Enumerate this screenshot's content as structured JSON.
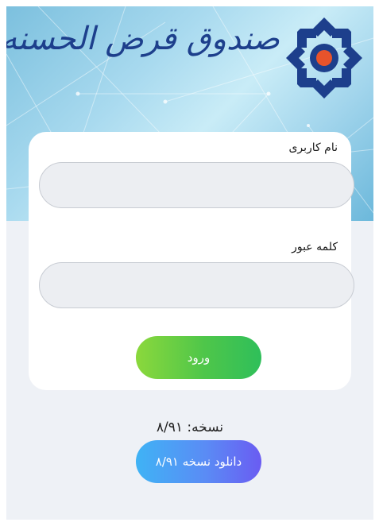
{
  "header": {
    "logo_text": "صندوق قرض الحسنه جام جم",
    "logo_icon": "fund-emblem-icon"
  },
  "login_form": {
    "username_label": "نام کاربری",
    "username_value": "",
    "password_label": "کلمه عبور",
    "password_value": "",
    "submit_label": "ورود"
  },
  "footer": {
    "version_text": "نسخه: ۸/۹۱",
    "download_label": "دانلود نسخه ۸/۹۱"
  },
  "colors": {
    "brand_blue": "#1d3f8c",
    "login_button": "#4ec64a",
    "download_button": "#5a8cf5",
    "page_background": "#eef1f6"
  }
}
